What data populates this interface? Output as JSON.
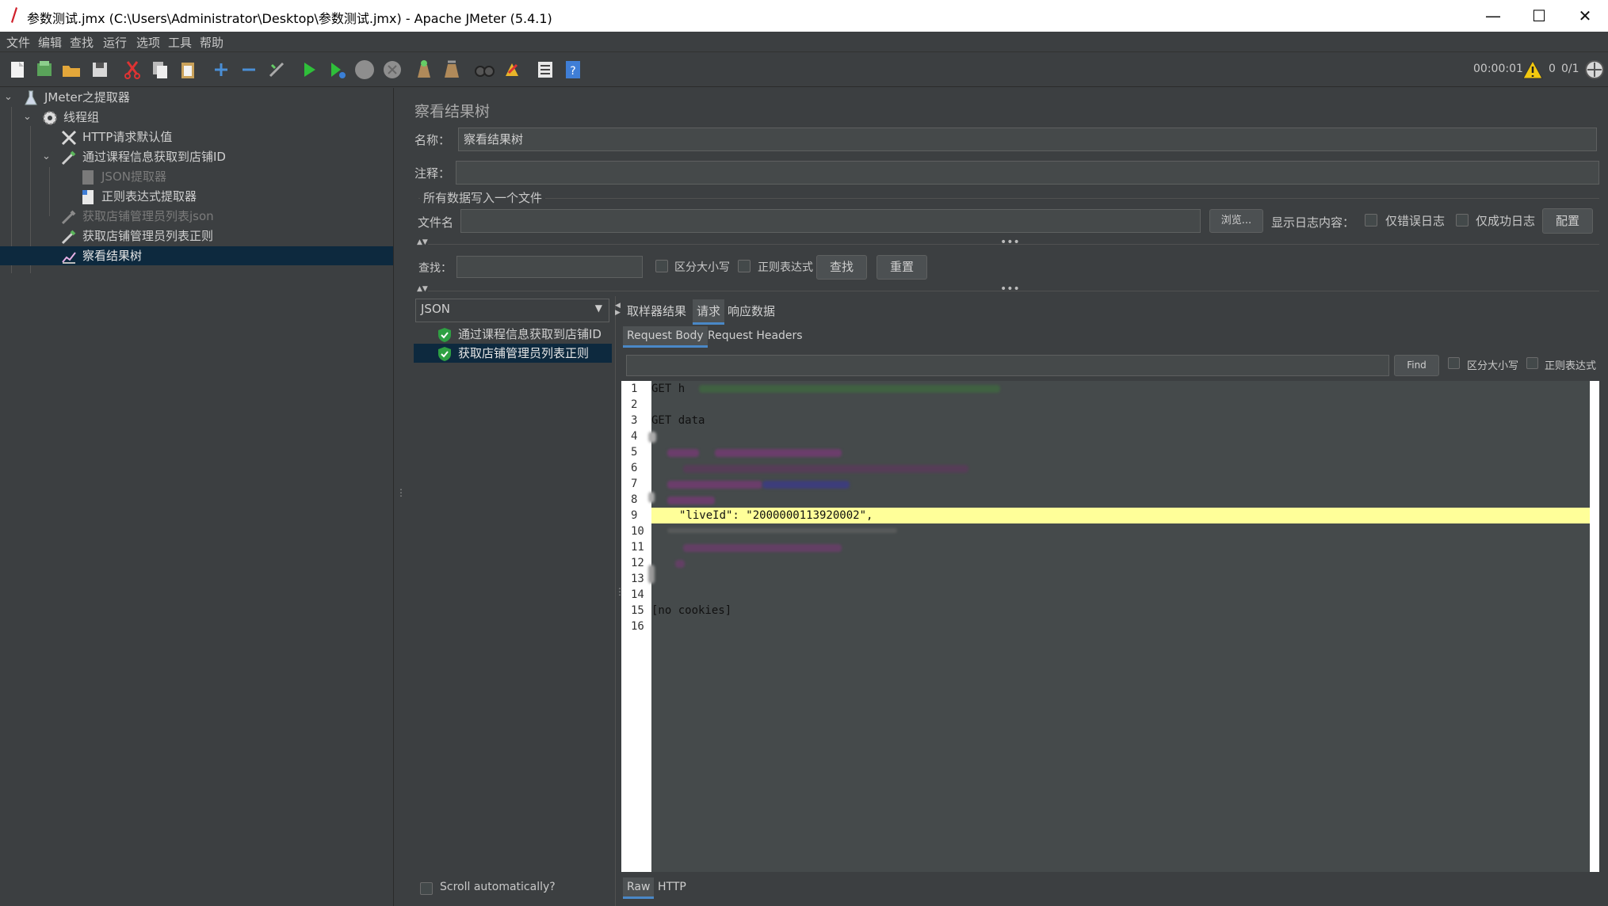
{
  "window": {
    "title": "参数测试.jmx (C:\\Users\\Administrator\\Desktop\\参数测试.jmx) - Apache JMeter (5.4.1)",
    "minimize": "—",
    "maximize": "☐",
    "close": "✕"
  },
  "menu": [
    "文件",
    "编辑",
    "查找",
    "运行",
    "选项",
    "工具",
    "帮助"
  ],
  "toolbar": {
    "timer": "00:00:01",
    "warn_count": "0",
    "thread_count": "0/1"
  },
  "tree": [
    {
      "label": "JMeter之提取器",
      "icon": "flask-icon"
    },
    {
      "label": "线程组",
      "icon": "gear-icon"
    },
    {
      "label": "HTTP请求默认值",
      "icon": "wrench-icon"
    },
    {
      "label": "通过课程信息获取到店铺ID",
      "icon": "pipette-icon"
    },
    {
      "label": "JSON提取器",
      "icon": "doc-icon"
    },
    {
      "label": "正则表达式提取器",
      "icon": "doc-icon"
    },
    {
      "label": "获取店铺管理员列表json",
      "icon": "pipette-icon"
    },
    {
      "label": "获取店铺管理员列表正则",
      "icon": "pipette-icon"
    },
    {
      "label": "察看结果树",
      "icon": "chart-icon"
    }
  ],
  "panel": {
    "title": "察看结果树",
    "name_label": "名称：",
    "name_value": "察看结果树",
    "comment_label": "注释：",
    "comment_value": "",
    "file_group": "所有数据写入一个文件",
    "filename_label": "文件名",
    "browse": "浏览...",
    "log_label": "显示日志内容：",
    "errors_only": "仅错误日志",
    "success_only": "仅成功日志",
    "configure": "配置",
    "search_label": "查找：",
    "case_sensitive": "区分大小写",
    "regex": "正则表达式",
    "find_btn": "查找",
    "reset_btn": "重置"
  },
  "results": {
    "renderer": "JSON",
    "samples": [
      "通过课程信息获取到店铺ID",
      "获取店铺管理员列表正则"
    ],
    "scroll_auto": "Scroll automatically?"
  },
  "tabs": [
    "取样器结果",
    "请求",
    "响应数据"
  ],
  "subtabs": [
    "Request Body",
    "Request Headers"
  ],
  "find": {
    "button": "Find",
    "case_sensitive": "区分大小写",
    "regex": "正则表达式"
  },
  "editor": {
    "line_numbers": [
      "1",
      "2",
      "3",
      "4",
      "5",
      "6",
      "7",
      "8",
      "9",
      "10",
      "11",
      "12",
      "13",
      "14",
      "15",
      "16"
    ],
    "line1": "GET h",
    "line3": "GET data",
    "line9": "\"liveId\": \"2000000113920002\",",
    "line15": "[no cookies]"
  },
  "bottom_tabs": [
    "Raw",
    "HTTP"
  ]
}
